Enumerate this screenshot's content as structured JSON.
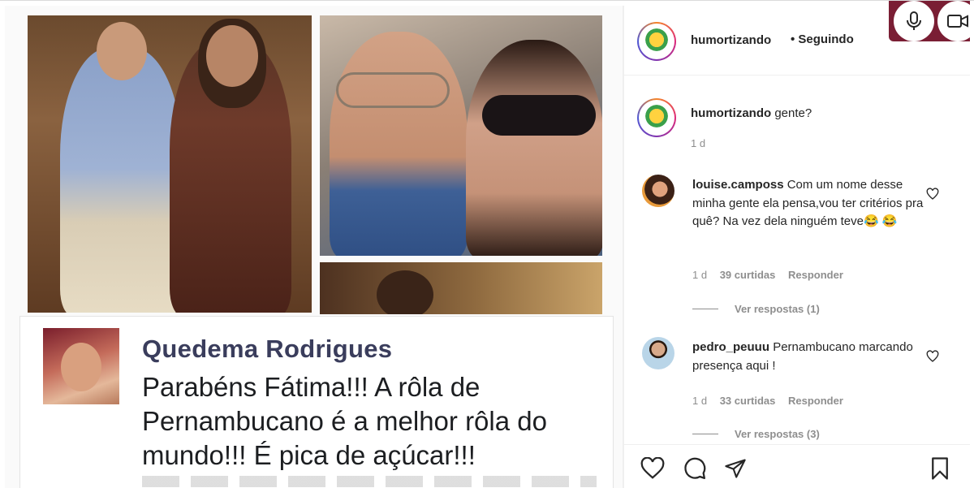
{
  "post": {
    "comment_card": {
      "author": "Quedema Rodrigues",
      "text": "Parabéns Fátima!!! A rôla de Pernambucano é a melhor rôla do mundo!!! É pica de açúcar!!!"
    }
  },
  "header": {
    "username": "humortizando",
    "follow_status": "• Seguindo"
  },
  "caption": {
    "username": "humortizando",
    "text": "gente?",
    "time": "1 d"
  },
  "comments": [
    {
      "username": "louise.camposs",
      "text": "Com um nome desse minha gente ela pensa,vou ter critérios pra quê? Na vez dela ninguém teve😂 😂",
      "time": "1 d",
      "likes": "39 curtidas",
      "reply_label": "Responder",
      "view_replies": "Ver respostas (1)"
    },
    {
      "username": "pedro_peuuu",
      "text": "Pernambucano marcando presença aqui !",
      "time": "1 d",
      "likes": "33 curtidas",
      "reply_label": "Responder",
      "view_replies": "Ver respostas (3)"
    }
  ],
  "icons": {
    "like": "heart-icon",
    "comment": "comment-icon",
    "share": "send-icon",
    "save": "bookmark-icon",
    "mic": "microphone-icon",
    "camera": "video-camera-icon"
  },
  "colors": {
    "text_primary": "#262626",
    "text_secondary": "#8e8e8e",
    "divider": "#efefef",
    "card_name": "#3a3d5c"
  }
}
